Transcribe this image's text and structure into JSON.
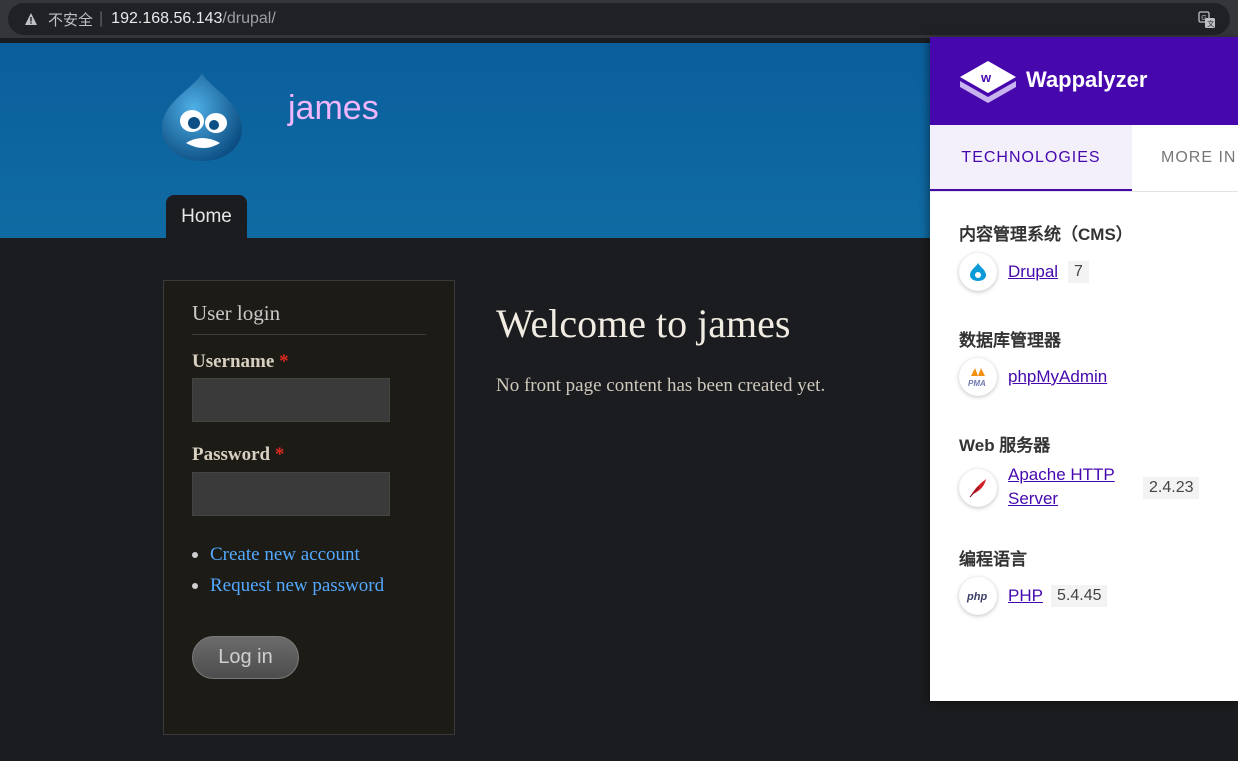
{
  "browser": {
    "security_label": "不安全",
    "separator": "|",
    "url_host": "192.168.56.143",
    "url_path": "/drupal/"
  },
  "site": {
    "name": "james",
    "nav": {
      "home": "Home"
    }
  },
  "login": {
    "title": "User login",
    "username_label": "Username",
    "password_label": "Password",
    "required_mark": "*",
    "links": [
      "Create new account",
      "Request new password"
    ],
    "button": "Log in"
  },
  "main": {
    "heading": "Welcome to james",
    "body": "No front page content has been created yet."
  },
  "wappalyzer": {
    "brand": "Wappalyzer",
    "tabs": {
      "technologies": "TECHNOLOGIES",
      "more": "MORE IN"
    },
    "categories": [
      {
        "title": "内容管理系统（CMS）",
        "name": "Drupal",
        "version": "7",
        "icon": "drupal-icon"
      },
      {
        "title": "数据库管理器",
        "name": "phpMyAdmin",
        "version": "",
        "icon": "phpmyadmin-icon",
        "icon_text": "PMA"
      },
      {
        "title": "Web 服务器",
        "name_line1": "Apache HTTP",
        "name_line2": "Server",
        "version": "2.4.23",
        "icon": "apache-feather-icon"
      },
      {
        "title": "编程语言",
        "name": "PHP",
        "version": "5.4.45",
        "icon": "php-icon",
        "icon_text": "php"
      }
    ]
  },
  "colors": {
    "header_blue": "#0a5f9c",
    "site_name": "#f0b6ff",
    "link_blue": "#53a9ff",
    "wappalyzer_purple": "#4608ad",
    "required_red": "#e02a20"
  }
}
